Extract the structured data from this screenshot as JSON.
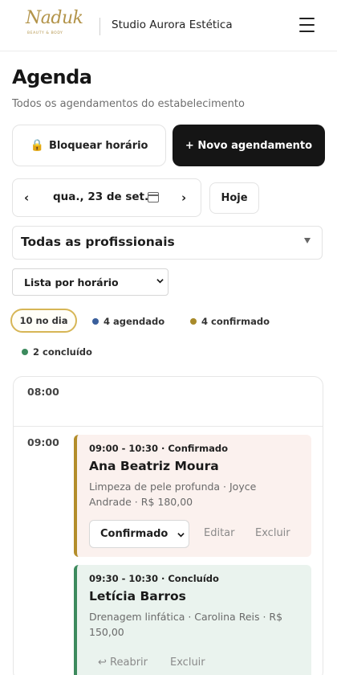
{
  "header": {
    "logo_text": "Naduk",
    "logo_subtext": "BEAUTY & BODY",
    "studio_name": "Studio Aurora Estética"
  },
  "page": {
    "title": "Agenda",
    "subtitle": "Todos os agendamentos do estabelecimento"
  },
  "actions": {
    "block_label": "Bloquear horário",
    "new_label": "+ Novo agendamento"
  },
  "date_nav": {
    "prev": "‹",
    "date": "qua., 23 de set.",
    "next": "›",
    "today": "Hoje"
  },
  "filters": {
    "professional": "Todas as profissionais",
    "view": "Lista por horário"
  },
  "chips": {
    "total": "10 no dia",
    "scheduled": "4 agendado",
    "confirmed": "4 confirmado",
    "done": "2 concluído"
  },
  "colors": {
    "scheduled": "#3a5f9c",
    "confirmed": "#a88a2a",
    "done": "#3c8a5d",
    "accent_gold": "#d7b656",
    "primary_dark": "#151515"
  },
  "slots": [
    {
      "time": "08:00"
    },
    {
      "time": "09:00"
    }
  ],
  "appointments": [
    {
      "meta": "09:00 - 10:30 · Confirmado",
      "client": "Ana Beatriz Moura",
      "service": "Limpeza de pele profunda · Joyce Andrade · R$ 180,00",
      "status_select": "Confirmado",
      "action_1": "Editar",
      "action_2": "Excluir"
    },
    {
      "meta": "09:30 - 10:30 · Concluído",
      "client": "Letícia Barros",
      "service": "Drenagem linfática · Carolina Reis · R$ 150,00",
      "action_1": "↩ Reabrir",
      "action_2": "Excluir"
    }
  ]
}
